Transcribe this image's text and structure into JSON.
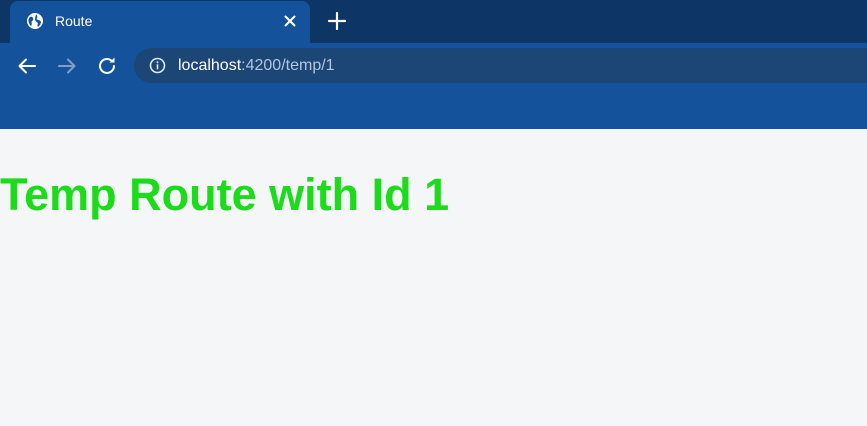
{
  "browser": {
    "tab": {
      "title": "Route",
      "favicon_icon": "globe-icon",
      "close_icon": "close-icon"
    },
    "new_tab_icon": "plus-icon",
    "nav": {
      "back_icon": "arrow-left-icon",
      "forward_icon": "arrow-right-icon",
      "reload_icon": "reload-icon"
    },
    "address_bar": {
      "info_icon": "info-icon",
      "host": "localhost",
      "rest": ":4200/temp/1"
    }
  },
  "page": {
    "heading": "Temp Route with Id 1"
  },
  "colors": {
    "tabstrip": "#0d3566",
    "toolbar": "#14539c",
    "omnibox": "#1b4676",
    "heading": "#1bdb1b",
    "page_bg": "#f5f6f8"
  }
}
